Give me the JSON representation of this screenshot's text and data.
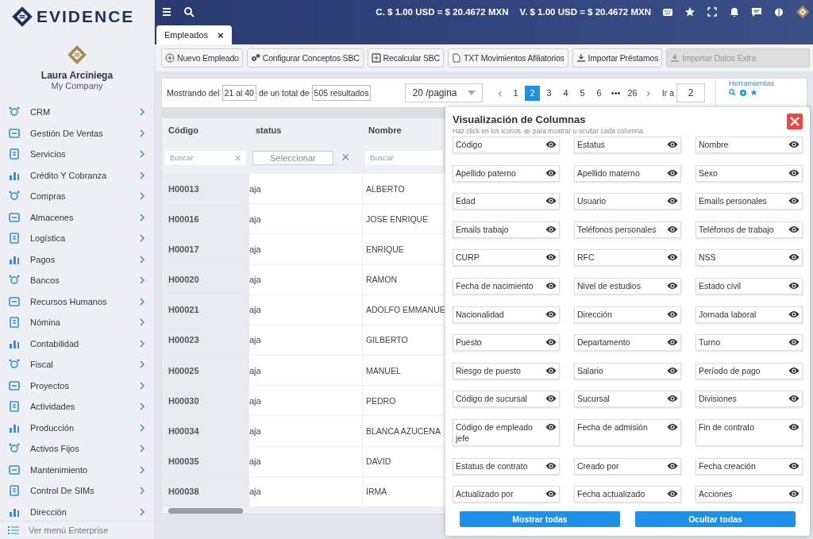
{
  "brand": {
    "name": "EVIDENCE"
  },
  "user": {
    "name": "Laura Arciniega",
    "company": "My Company"
  },
  "sidebar": {
    "items": [
      {
        "label": "CRM"
      },
      {
        "label": "Gestión De Ventas"
      },
      {
        "label": "Servicios"
      },
      {
        "label": "Crédito Y Cobranza"
      },
      {
        "label": "Compras"
      },
      {
        "label": "Almacenes"
      },
      {
        "label": "Logística"
      },
      {
        "label": "Pagos"
      },
      {
        "label": "Bancos"
      },
      {
        "label": "Recursos Humanos"
      },
      {
        "label": "Nómina"
      },
      {
        "label": "Contabilidad"
      },
      {
        "label": "Fiscal"
      },
      {
        "label": "Proyectos"
      },
      {
        "label": "Actividades"
      },
      {
        "label": "Producción"
      },
      {
        "label": "Activos Fijos"
      },
      {
        "label": "Mantenimiento"
      },
      {
        "label": "Control De SIMs"
      },
      {
        "label": "Dirección"
      }
    ],
    "footer": "Ver menú Enterprise"
  },
  "topbar": {
    "rates": [
      "C. $ 1.00 USD = $ 20.4672 MXN",
      "V. $ 1.00 USD = $ 20.4672 MXN"
    ]
  },
  "tabs": [
    {
      "label": "Empleados",
      "selected": true,
      "close": "×"
    }
  ],
  "toolbar": [
    {
      "label": "Nuevo Empleado",
      "disabled": false
    },
    {
      "label": "Configurar Conceptos SBC",
      "disabled": false
    },
    {
      "label": "Recalcular SBC",
      "disabled": false
    },
    {
      "label": "TXT Movimientos Afiliatorios",
      "disabled": false
    },
    {
      "label": "Importar Préstamos",
      "disabled": false
    },
    {
      "label": "Importar Datos Extra",
      "disabled": true
    }
  ],
  "pager": {
    "showing_label": "Mostrando del",
    "range": "21 al 40",
    "total_label": "de un total de",
    "total": "505 resultados",
    "page_size": "20 /pagina",
    "prev": "‹",
    "next": "›",
    "pages": [
      {
        "label": "1",
        "selected": false
      },
      {
        "label": "2",
        "selected": true
      },
      {
        "label": "3",
        "selected": false
      },
      {
        "label": "4",
        "selected": false
      },
      {
        "label": "5",
        "selected": false
      },
      {
        "label": "6",
        "selected": false
      },
      {
        "label": "•••",
        "selected": false
      },
      {
        "label": "26",
        "selected": false
      }
    ],
    "goto_label": "Ir a",
    "goto_value": "2",
    "tools_label": "Herramientas"
  },
  "table": {
    "columns": [
      "Código",
      "status",
      "Nombre"
    ],
    "filters": [
      {
        "kind": "search",
        "placeholder": "Buscar",
        "clear": "×"
      },
      {
        "kind": "select",
        "placeholder": "Seleccionar",
        "clear": "×"
      },
      {
        "kind": "search",
        "placeholder": "Buscar"
      }
    ],
    "rows": [
      [
        "H00013",
        "aja",
        "ALBERTO"
      ],
      [
        "H00016",
        "aja",
        "JOSE ENRIQUE"
      ],
      [
        "H00017",
        "aja",
        "ENRIQUE"
      ],
      [
        "H00020",
        "aja",
        "RAMON"
      ],
      [
        "H00021",
        "aja",
        "ADOLFO EMMANUE"
      ],
      [
        "H00023",
        "aja",
        "GILBERTO"
      ],
      [
        "H00025",
        "aja",
        "MANUEL"
      ],
      [
        "H00030",
        "aja",
        "PEDRO"
      ],
      [
        "H00034",
        "aja",
        "BLANCA AZUCENA"
      ],
      [
        "H00035",
        "aja",
        "DAVID"
      ],
      [
        "H00038",
        "aja",
        "IRMA"
      ]
    ]
  },
  "modal": {
    "title": "Visualización de Columnas",
    "hint_before": "Haz click en los iconos",
    "hint_after": "para mostrar u ocultar cada columna.",
    "columns": [
      {
        "label": "Código",
        "visible": true
      },
      {
        "label": "Estatus",
        "visible": true
      },
      {
        "label": "Nombre",
        "visible": true
      },
      {
        "label": "Apellido paterno",
        "visible": true
      },
      {
        "label": "Apellido materno",
        "visible": true
      },
      {
        "label": "Sexo",
        "visible": true
      },
      {
        "label": "Edad",
        "visible": true
      },
      {
        "label": "Usuario",
        "visible": true
      },
      {
        "label": "Emails personales",
        "visible": true
      },
      {
        "label": "Emails trabajo",
        "visible": true
      },
      {
        "label": "Teléfonos personales",
        "visible": true
      },
      {
        "label": "Teléfonos de trabajo",
        "visible": true
      },
      {
        "label": "CURP",
        "visible": true
      },
      {
        "label": "RFC",
        "visible": true
      },
      {
        "label": "NSS",
        "visible": true
      },
      {
        "label": "Fecha de nacimiento",
        "visible": true
      },
      {
        "label": "Nivel de estudios",
        "visible": true
      },
      {
        "label": "Estado civil",
        "visible": true
      },
      {
        "label": "Nacionalidad",
        "visible": true
      },
      {
        "label": "Dirección",
        "visible": true
      },
      {
        "label": "Jornada laboral",
        "visible": true
      },
      {
        "label": "Puesto",
        "visible": true
      },
      {
        "label": "Departamento",
        "visible": true
      },
      {
        "label": "Turno",
        "visible": true
      },
      {
        "label": "Riesgo de puesto",
        "visible": true
      },
      {
        "label": "Salario",
        "visible": true
      },
      {
        "label": "Período de pago",
        "visible": true
      },
      {
        "label": "Código de sucursal",
        "visible": true
      },
      {
        "label": "Sucursal",
        "visible": true
      },
      {
        "label": "Divisiones",
        "visible": true
      },
      {
        "label": "Código de empleado jefe",
        "visible": true
      },
      {
        "label": "Fecha de admisión",
        "visible": true
      },
      {
        "label": "Fin de contrato",
        "visible": true
      },
      {
        "label": "Estatus de contrato",
        "visible": true
      },
      {
        "label": "Creado por",
        "visible": true
      },
      {
        "label": "Fecha creación",
        "visible": true
      },
      {
        "label": "Actualizado por",
        "visible": true
      },
      {
        "label": "Fecha actualizado",
        "visible": true
      },
      {
        "label": "Acciones",
        "visible": true
      }
    ],
    "buttons": [
      "Mostrar todas",
      "Ocultar todas"
    ]
  }
}
